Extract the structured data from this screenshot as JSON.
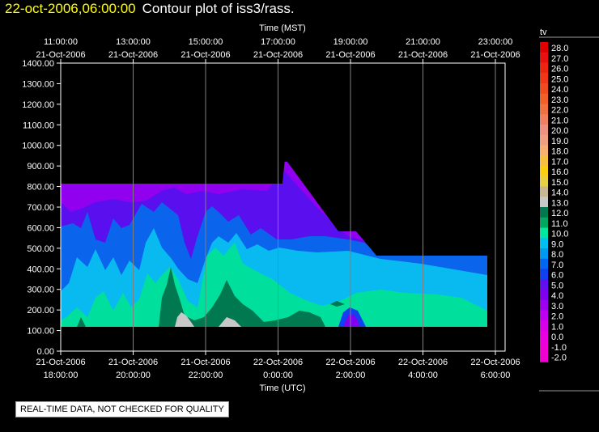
{
  "header": {
    "timestamp": "22-oct-2006,06:00:00",
    "title": "Contour plot of iss3/rass."
  },
  "notice": "REAL-TIME DATA, NOT CHECKED FOR QUALITY",
  "colors": {
    "background": "#000000",
    "timestamp": "#ffff00",
    "grid": "#808080"
  },
  "chart_data": {
    "type": "heatmap",
    "title": "Contour plot of iss3/rass.",
    "top_axis": {
      "label": "Time (MST)",
      "ticks": [
        [
          "11:00:00",
          "21-Oct-2006"
        ],
        [
          "13:00:00",
          "21-Oct-2006"
        ],
        [
          "15:00:00",
          "21-Oct-2006"
        ],
        [
          "17:00:00",
          "21-Oct-2006"
        ],
        [
          "19:00:00",
          "21-Oct-2006"
        ],
        [
          "21:00:00",
          "21-Oct-2006"
        ],
        [
          "23:00:00",
          "21-Oct-2006"
        ]
      ]
    },
    "bottom_axis": {
      "label": "Time (UTC)",
      "ticks": [
        [
          "21-Oct-2006",
          "18:00:00"
        ],
        [
          "21-Oct-2006",
          "20:00:00"
        ],
        [
          "21-Oct-2006",
          "22:00:00"
        ],
        [
          "22-Oct-2006",
          "0:00:00"
        ],
        [
          "22-Oct-2006",
          "2:00:00"
        ],
        [
          "22-Oct-2006",
          "4:00:00"
        ],
        [
          "22-Oct-2006",
          "6:00:00"
        ]
      ]
    },
    "x_hours_utc_range": [
      18,
      30.2
    ],
    "y_axis": {
      "ticks": [
        "0.00",
        "100.00",
        "200.00",
        "300.00",
        "400.00",
        "500.00",
        "600.00",
        "700.00",
        "800.00",
        "900.00",
        "1000.00",
        "1100.00",
        "1200.00",
        "1300.00",
        "1400.00"
      ],
      "range": [
        0,
        1400
      ]
    },
    "grid": true,
    "colorbar": {
      "label": "tv",
      "levels": [
        {
          "label": "28.0",
          "color": "#e00000"
        },
        {
          "label": "27.0",
          "color": "#e81010"
        },
        {
          "label": "26.0",
          "color": "#ec2410"
        },
        {
          "label": "25.0",
          "color": "#f03818"
        },
        {
          "label": "24.0",
          "color": "#f04c20"
        },
        {
          "label": "23.0",
          "color": "#f06028"
        },
        {
          "label": "22.0",
          "color": "#f07040"
        },
        {
          "label": "21.0",
          "color": "#f08060"
        },
        {
          "label": "20.0",
          "color": "#f09080"
        },
        {
          "label": "19.0",
          "color": "#f0a080"
        },
        {
          "label": "18.0",
          "color": "#f8b070"
        },
        {
          "label": "17.0",
          "color": "#f8c040"
        },
        {
          "label": "16.0",
          "color": "#f8d010"
        },
        {
          "label": "15.0",
          "color": "#e8d040"
        },
        {
          "label": "14.0",
          "color": "#c8b890"
        },
        {
          "label": "13.0",
          "color": "#c8c8c8"
        },
        {
          "label": "12.0",
          "color": "#007850"
        },
        {
          "label": "11.0",
          "color": "#00a860"
        },
        {
          "label": "10.0",
          "color": "#00e8a0"
        },
        {
          "label": "9.0",
          "color": "#00c0f0"
        },
        {
          "label": "8.0",
          "color": "#0098f0"
        },
        {
          "label": "7.0",
          "color": "#0068f0"
        },
        {
          "label": "6.0",
          "color": "#1040f0"
        },
        {
          "label": "5.0",
          "color": "#6010f0"
        },
        {
          "label": "4.0",
          "color": "#8000f0"
        },
        {
          "label": "3.0",
          "color": "#a000f0"
        },
        {
          "label": "2.0",
          "color": "#c000f0"
        },
        {
          "label": "1.0",
          "color": "#d800e8"
        },
        {
          "label": "0.0",
          "color": "#e800e0"
        },
        {
          "label": "-1.0",
          "color": "#f000d8"
        },
        {
          "label": "-2.0",
          "color": "#f000d0"
        }
      ]
    }
  }
}
